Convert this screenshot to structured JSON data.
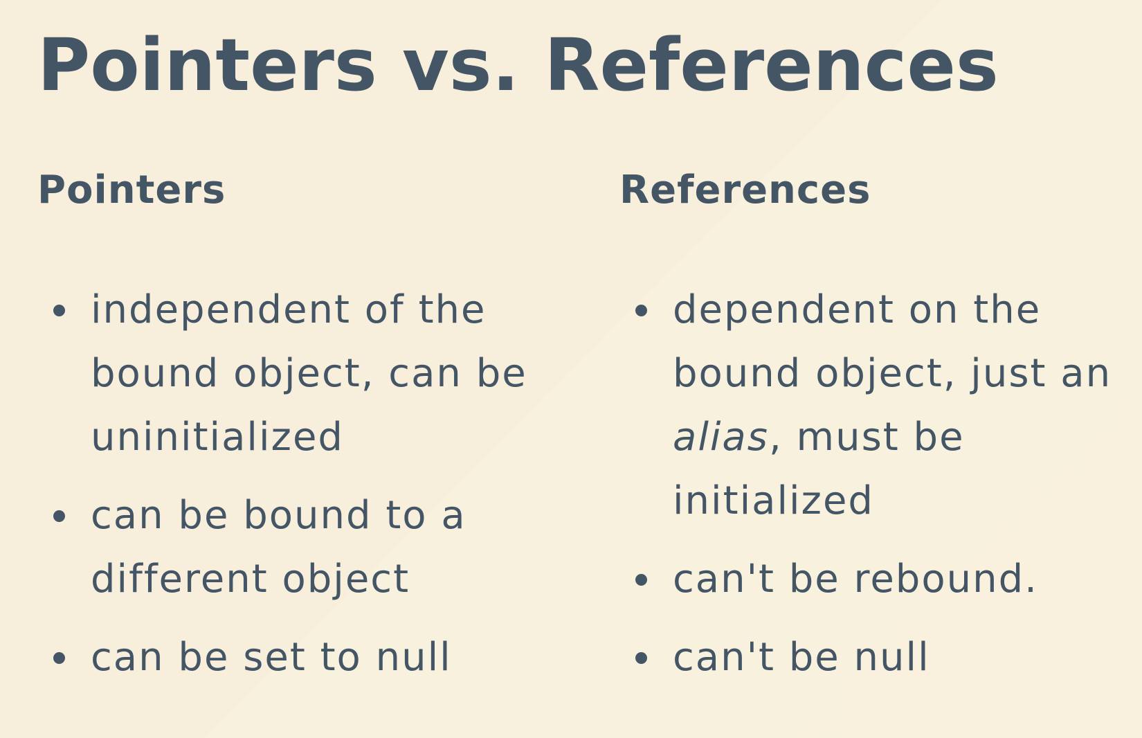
{
  "title": "Pointers vs. References",
  "left": {
    "heading": "Pointers",
    "items": [
      {
        "lines": [
          "independent of the",
          "bound object, can be",
          "uninitialized"
        ]
      },
      {
        "lines": [
          "can be bound to a",
          "different object"
        ]
      },
      {
        "lines": [
          "can be set to null"
        ]
      }
    ]
  },
  "right": {
    "heading": "References",
    "items": [
      {
        "lines": [
          "dependent on the",
          "bound object, just an"
        ],
        "italic_word": "alias",
        "after_italic": ", must be",
        "last_line": "initialized"
      },
      {
        "lines": [
          "can't be rebound."
        ]
      },
      {
        "lines": [
          "can't be null"
        ]
      }
    ]
  },
  "colors": {
    "text": "#445565",
    "background": "#f7eedb"
  }
}
